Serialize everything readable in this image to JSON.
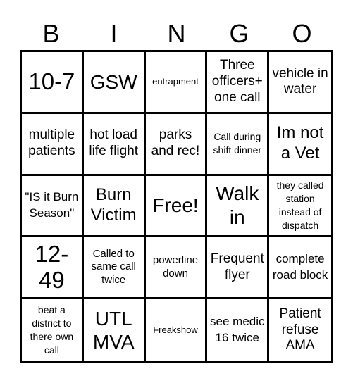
{
  "header": {
    "letters": [
      "B",
      "I",
      "N",
      "G",
      "O"
    ]
  },
  "cells": [
    [
      "10-7",
      "GSW",
      "entrapment",
      "Three officers+ one call",
      "vehicle in water"
    ],
    [
      "multiple patients",
      "hot load life flight",
      "parks and rec!",
      "Call during shift dinner",
      "Im not a Vet"
    ],
    [
      "\"IS it Burn Season\"",
      "Burn Victim",
      "Free!",
      "Walk in",
      "they called station instead of dispatch"
    ],
    [
      "12-49",
      "Called to same call twice",
      "powerline down",
      "Frequent flyer",
      "complete road block"
    ],
    [
      "beat a district to there own call",
      "UTL MVA",
      "Freakshow",
      "see medic 16 twice",
      "Patient refuse AMA"
    ]
  ],
  "free_space": {
    "row": 2,
    "col": 2
  }
}
